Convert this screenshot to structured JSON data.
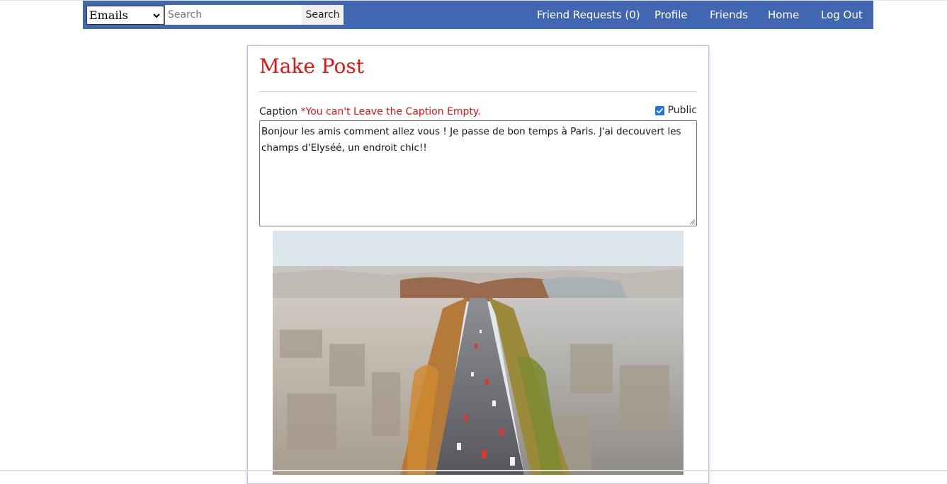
{
  "navbar": {
    "filter_select": {
      "value": "Emails",
      "options": [
        "Emails"
      ]
    },
    "search": {
      "placeholder": "Search",
      "button_label": "Search"
    },
    "links": {
      "friend_requests": "Friend Requests (0)",
      "profile": "Profile",
      "friends": "Friends",
      "home": "Home",
      "logout": "Log Out"
    },
    "color": "#4267b2"
  },
  "post_form": {
    "title": "Make Post",
    "caption_label": "Caption",
    "caption_error": "*You can't Leave the Caption Empty.",
    "public_label": "Public",
    "public_checked": true,
    "caption_text": "Bonjour les amis comment allez vous ! Je passe de bon temps à Paris. J'ai decouvert les champs d'Elyséé, un endroit chic!!",
    "accent_color": "#e8120e"
  },
  "icons": {
    "select_arrow": "chevron-down-icon",
    "checkbox": "checkmark-icon",
    "textarea": "resize-grip-icon"
  }
}
